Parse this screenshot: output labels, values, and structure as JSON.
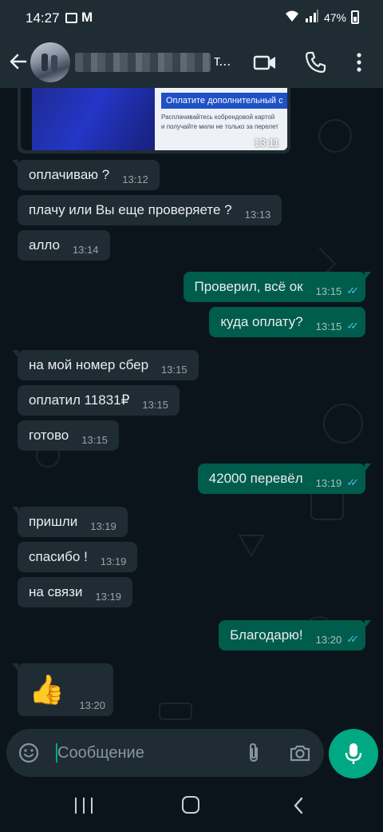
{
  "status_bar": {
    "time": "14:27",
    "battery": "47%"
  },
  "header": {
    "contact_suffix": "т..."
  },
  "image_message": {
    "banner": "Оплатите дополнительный с",
    "line1": "Расплачивайтесь кобрендовой картой",
    "line2": "и получайте мили не только за перелет",
    "time": "13:11"
  },
  "messages": [
    {
      "dir": "in",
      "text": "оплачиваю ?",
      "time": "13:12"
    },
    {
      "dir": "in",
      "text": "плачу или Вы еще проверяете ?",
      "time": "13:13"
    },
    {
      "dir": "in",
      "text": "алло",
      "time": "13:14"
    },
    {
      "dir": "out",
      "text": "Проверил, всё ок",
      "time": "13:15"
    },
    {
      "dir": "out",
      "text": "куда оплату?",
      "time": "13:15"
    },
    {
      "dir": "in",
      "text": "на мой номер сбер",
      "time": "13:15"
    },
    {
      "dir": "in",
      "text": "оплатил 11831₽",
      "time": "13:15"
    },
    {
      "dir": "in",
      "text": "готово",
      "time": "13:15"
    },
    {
      "dir": "out",
      "text": "42000 перевёл",
      "time": "13:19"
    },
    {
      "dir": "in",
      "text": "пришли",
      "time": "13:19"
    },
    {
      "dir": "in",
      "text": "спасибо !",
      "time": "13:19"
    },
    {
      "dir": "in",
      "text": "на связи",
      "time": "13:19"
    },
    {
      "dir": "out",
      "text": "Благодарю!",
      "time": "13:20"
    }
  ],
  "thumb_message": {
    "emoji": "👍",
    "time": "13:20"
  },
  "input": {
    "placeholder": "Сообщение"
  },
  "colors": {
    "incoming": "#1f2c34",
    "outgoing": "#005c4b",
    "accent": "#00a884",
    "read_ticks": "#53bdeb",
    "background": "#0b141a"
  },
  "icons": [
    "back-arrow-icon",
    "video-call-icon",
    "voice-call-icon",
    "more-options-icon",
    "emoji-icon",
    "attach-icon",
    "camera-icon",
    "mic-icon"
  ]
}
